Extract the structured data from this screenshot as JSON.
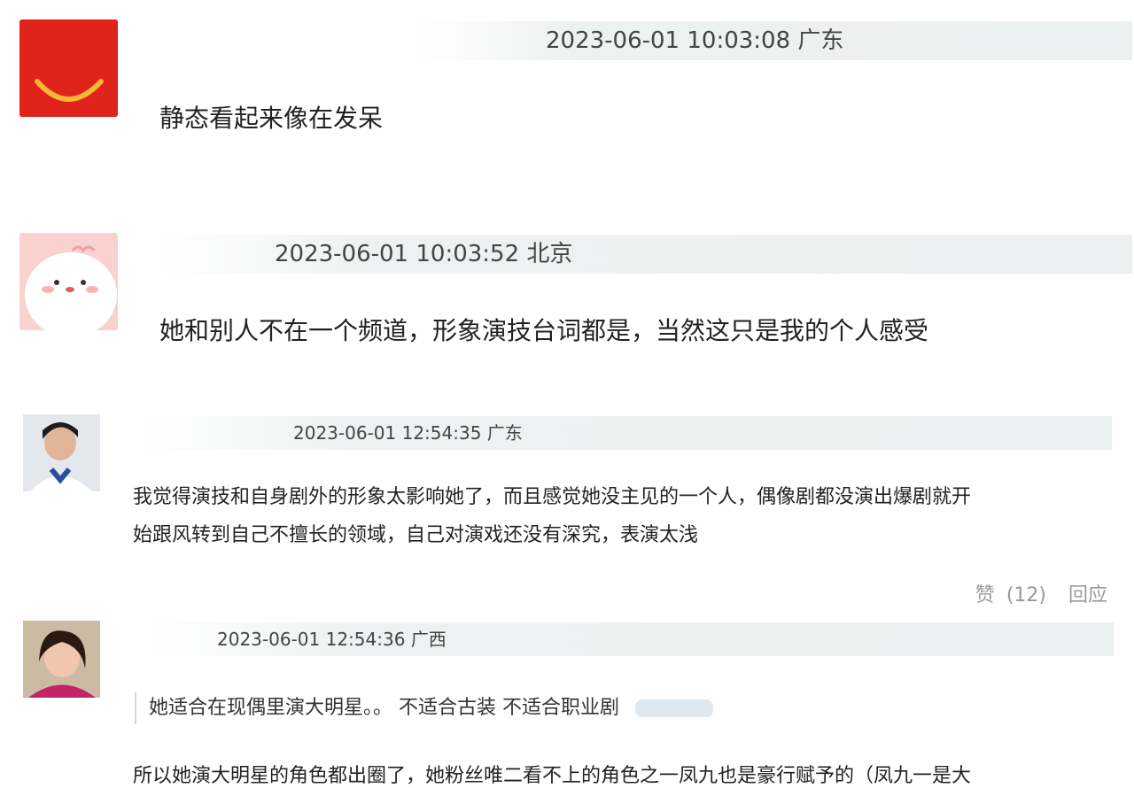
{
  "comments": [
    {
      "timestamp": "2023-06-01 10:03:08",
      "location": "广东",
      "text": "静态看起来像在发呆",
      "avatar_icon": "happy-box-icon",
      "avatar_color": "#e0231b"
    },
    {
      "timestamp": "2023-06-01 10:03:52",
      "location": "北京",
      "text": "她和别人不在一个频道，形象演技台词都是，当然这只是我的个人感受",
      "avatar_icon": "cartoon-face-icon",
      "avatar_color": "#f9d2d0"
    },
    {
      "timestamp": "2023-06-01 12:54:35",
      "location": "广东",
      "text_line1": "我觉得演技和自身剧外的形象太影响她了，而且感觉她没主见的一个人，偶像剧都没演出爆剧就开",
      "text_line2": "始跟风转到自己不擅长的领域，自己对演戏还没有深究，表演太浅",
      "like_label": "赞",
      "like_count": "(12)",
      "reply_label": "回应",
      "avatar_icon": "user-photo-icon"
    },
    {
      "timestamp": "2023-06-01 12:54:36",
      "location": "广西",
      "quote": "她适合在现偶里演大明星。。 不适合古装 不适合职业剧",
      "text": "所以她演大明星的角色都出圈了，她粉丝唯二看不上的角色之一凤九也是豪行赋予的（凤九一是大",
      "avatar_icon": "user-photo-icon"
    }
  ]
}
